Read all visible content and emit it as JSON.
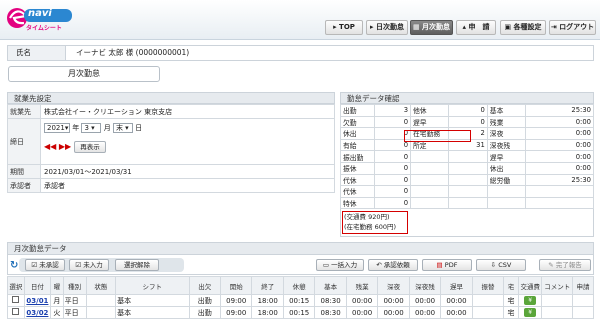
{
  "header": {
    "logo_main": "navi",
    "logo_sub": "タイムシート",
    "nav": [
      "TOP",
      "日次勤怠",
      "月次勤怠",
      "申　請",
      "各種設定",
      "ログアウト"
    ]
  },
  "employee": {
    "label": "氏名",
    "value": "イーナビ 太郎 様 (0000000001)"
  },
  "page_title": "月次勤怠",
  "workplace": {
    "title": "就業先設定",
    "rows": [
      {
        "label": "就業先",
        "value": "株式会社イー・クリエーション 東京支店"
      },
      {
        "label": "期間",
        "value": "2021/03/01～2021/03/31"
      },
      {
        "label": "承認者",
        "value": "承認者"
      }
    ],
    "date_label": "締日",
    "year": "2021",
    "year_unit": "年",
    "month": "3",
    "month_unit": "月",
    "day": "末",
    "day_unit": "日",
    "reshow": "再表示"
  },
  "summary": {
    "title": "勤怠データ確認",
    "rows": [
      [
        "出勤",
        "3",
        "他休",
        "0",
        "基本",
        "25:30"
      ],
      [
        "欠勤",
        "0",
        "遅早",
        "0",
        "残業",
        "0:00"
      ],
      [
        "休出",
        "0",
        "在宅勤務",
        "2",
        "深夜",
        "0:00"
      ],
      [
        "有給",
        "0",
        "所定",
        "31",
        "深夜残",
        "0:00"
      ],
      [
        "振出勤",
        "0",
        "",
        "",
        "遅早",
        "0:00"
      ],
      [
        "振休",
        "0",
        "",
        "",
        "休出",
        "0:00"
      ],
      [
        "代休",
        "0",
        "",
        "",
        "総労働",
        "25:30"
      ],
      [
        "代休",
        "0",
        "",
        "",
        "",
        ""
      ],
      [
        "特休",
        "0",
        "",
        "",
        "",
        ""
      ]
    ],
    "note1": "(交通費 920円)",
    "note2": "(在宅勤務 600円)"
  },
  "monthly": {
    "title": "月次勤怠データ",
    "btn_unapproved": "未承認",
    "btn_unentered": "未入力",
    "btn_clear": "選択解除",
    "btn_bulk": "一括入力",
    "btn_request": "承認依頼",
    "btn_pdf": "PDF",
    "btn_csv": "CSV",
    "btn_done": "完了報告",
    "columns": [
      "選択",
      "日付",
      "曜",
      "種別",
      "状態",
      "シフト",
      "出欠",
      "開始",
      "終了",
      "休憩",
      "基本",
      "残業",
      "深夜",
      "深夜残",
      "遅早",
      "振替",
      "宅",
      "交通費",
      "コメント",
      "申請"
    ],
    "rows": [
      [
        "03/01",
        "月",
        "平日",
        "",
        "基本",
        "出勤",
        "09:00",
        "18:00",
        "00:15",
        "08:30",
        "00:00",
        "00:00",
        "00:00",
        "00:00",
        "",
        "宅"
      ],
      [
        "03/02",
        "火",
        "平日",
        "",
        "基本",
        "出勤",
        "09:00",
        "18:00",
        "00:15",
        "08:30",
        "00:00",
        "00:00",
        "00:00",
        "00:00",
        "",
        "宅"
      ]
    ]
  },
  "colors": {
    "accent": "#e3007f",
    "nav_active": "#6a6a6a",
    "highlight_border": "#d40000",
    "green_badge": "#5aa53a"
  }
}
